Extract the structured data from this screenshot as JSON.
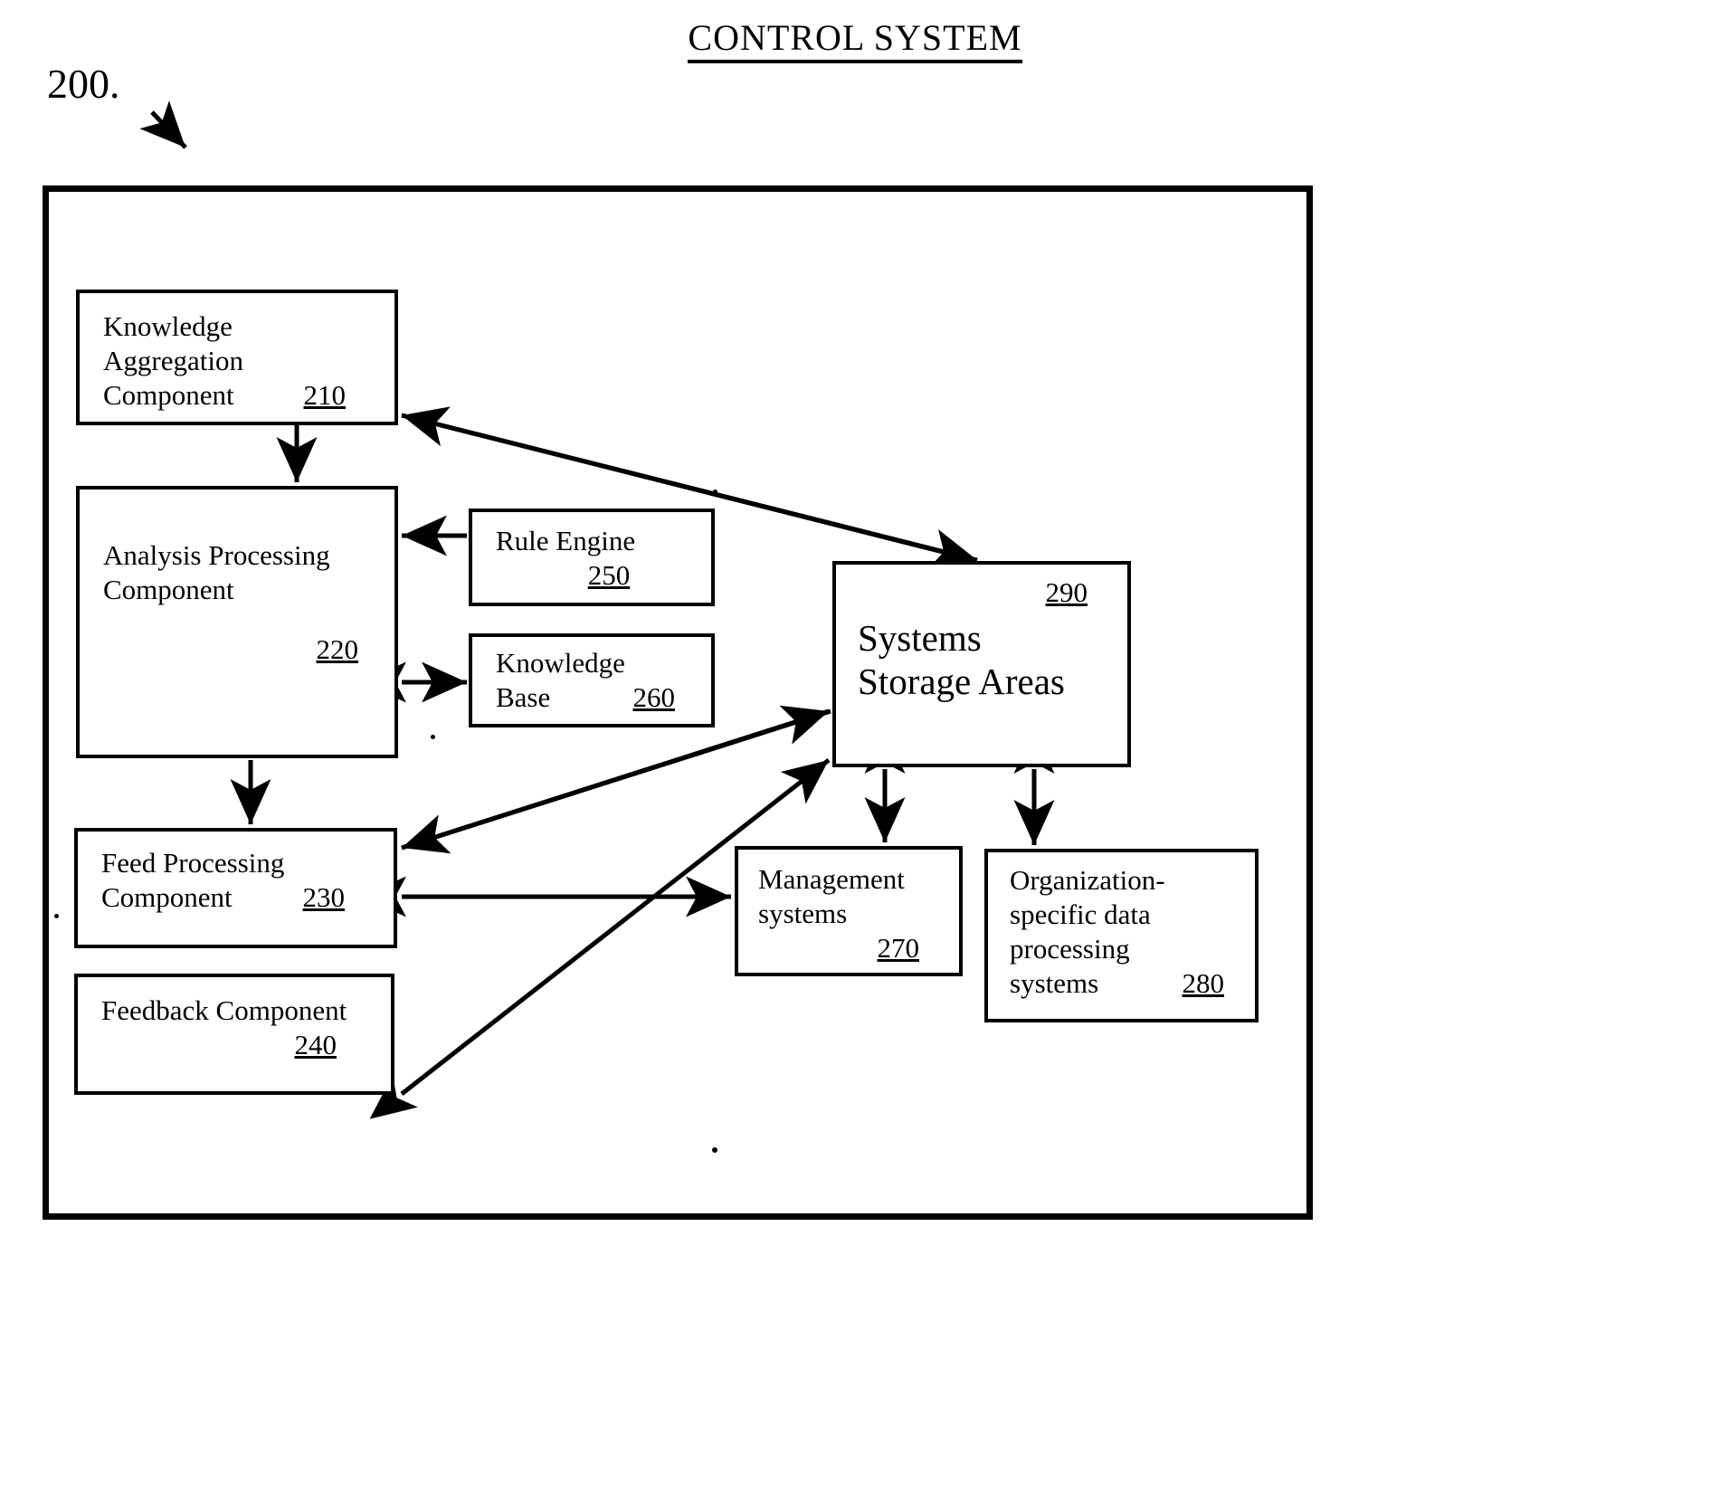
{
  "figure": {
    "title": "CONTROL SYSTEM",
    "ref_number": "200."
  },
  "nodes": {
    "knowledge_aggregation": {
      "line1": "Knowledge",
      "line2": "Aggregation",
      "line3": "Component",
      "ref": "210"
    },
    "analysis_processing": {
      "line1": "Analysis Processing",
      "line2": "Component",
      "ref": "220"
    },
    "feed_processing": {
      "line1": "Feed Processing",
      "line2": "Component",
      "ref": "230"
    },
    "feedback": {
      "line1": "Feedback Component",
      "ref": "240"
    },
    "rule_engine": {
      "line1": "Rule Engine",
      "ref": "250"
    },
    "knowledge_base": {
      "line1": "Knowledge",
      "line2": "Base",
      "ref": "260"
    },
    "management_systems": {
      "line1": "Management",
      "line2": "systems",
      "ref": "270"
    },
    "org_specific_systems": {
      "line1": "Organization-",
      "line2": "specific data",
      "line3": "processing",
      "line4": "systems",
      "ref": "280"
    },
    "systems_storage_areas": {
      "line1": "Systems",
      "line2": "Storage Areas",
      "ref": "290"
    }
  },
  "colors": {
    "stroke": "#000000",
    "background": "#ffffff"
  }
}
